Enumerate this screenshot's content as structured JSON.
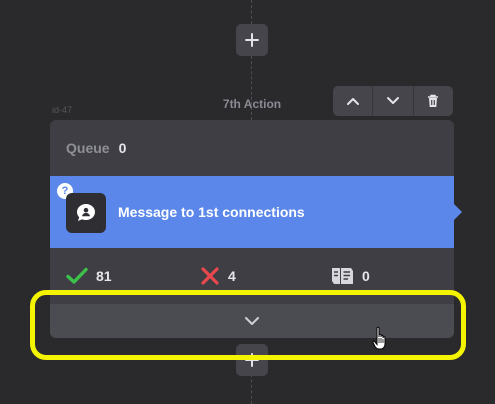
{
  "flow": {
    "node_id": "id-47",
    "action_label": "7th Action",
    "top_add_icon": "plus-icon",
    "bottom_add_icon": "plus-icon"
  },
  "toolbar": {
    "move_up_icon": "chevron-up-icon",
    "move_down_icon": "chevron-down-icon",
    "delete_icon": "trash-icon"
  },
  "card": {
    "queue_label": "Queue",
    "queue_count": "0",
    "message": {
      "help_badge": "?",
      "icon": "message-bubble-icon",
      "title": "Message to 1st connections"
    },
    "stats": {
      "success_icon": "checkmark-icon",
      "success_count": "81",
      "failed_icon": "x-mark-icon",
      "failed_count": "4",
      "skipped_icon": "skip-document-icon",
      "skipped_count": "0"
    },
    "expand_icon": "chevron-down-icon"
  },
  "colors": {
    "background": "#2a2a2d",
    "card": "#3e3e44",
    "accent_blue": "#5b87ea",
    "success_green": "#3cc24a",
    "error_red": "#e8484e",
    "highlight_yellow": "#f4f400"
  }
}
